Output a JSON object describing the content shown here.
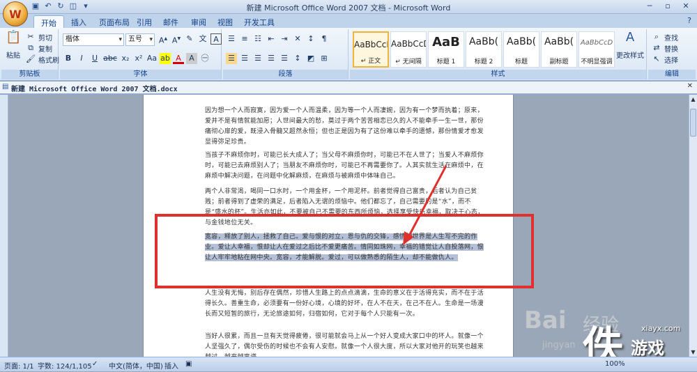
{
  "window": {
    "title": "新建 Microsoft Office Word 2007 文档 - Microsoft Word",
    "office_button_glyph": "W"
  },
  "ribbon_tabs": [
    "开始",
    "插入",
    "页面布局",
    "引用",
    "邮件",
    "审阅",
    "视图",
    "开发工具"
  ],
  "clipboard": {
    "paste": "粘贴",
    "cut": "剪切",
    "copy": "复制",
    "format_painter": "格式刷",
    "group_label": "剪贴板"
  },
  "font": {
    "name": "楷体",
    "size": "五号",
    "group_label": "字体"
  },
  "paragraph": {
    "group_label": "段落"
  },
  "styles": {
    "items": [
      {
        "preview": "AaBbCcD",
        "name": "↵ 正文"
      },
      {
        "preview": "AaBbCcD",
        "name": "↵ 无间隔"
      },
      {
        "preview": "AaB",
        "name": "标题 1"
      },
      {
        "preview": "AaBb(",
        "name": "标题 2"
      },
      {
        "preview": "AaBb(",
        "name": "标题"
      },
      {
        "preview": "AaBb(",
        "name": "副标题"
      },
      {
        "preview": "AaBbCcD",
        "name": "不明显强调"
      }
    ],
    "change_styles": "更改样式",
    "group_label": "样式"
  },
  "editing": {
    "find": "查找",
    "replace": "替换",
    "select": "选择",
    "group_label": "编辑"
  },
  "document_tab": "新建 Microsoft Office Word 2007 文档.docx",
  "document": {
    "p1": "因为想一个人而寂寞，因为爱一个人而温柔，因为等一个人而凄婉，因为有一个梦而执着；原来，爱并不是有情就能加愿；人世间最大的愁，莫过于两个苦苦相恋已久的人不能牵手一生一世，那份痛彻心扉的爱，既浸入骨髓又超然永恒；但也正是因为有了这份难以牵手的遗憾，那份情爱才愈发显得弥足珍贵。",
    "p2": "当孩子不麻烦你时，可能已长大成人了；当父母不麻烦你时，可能已不在人世了；当爱人不麻烦你时，可能已去麻烦别人了；当朋友不麻烦你时，可能已不再需要你了。人其实就生活在麻烦中，在麻烦中解决问题，在问题中化解麻烦，在麻烦与被麻烦中体味自己。",
    "p3": "两个人非常渴，喝同一口水时，一个用金杯，一个用泥杯。前者觉得自己富贵，后者认为自己贫贱；前者得到了虚荣的满足，后者陷入无谓的烦恼中。他们都忘了，自己需要的是“水”，而不是“盛水的杯”。生活亦如此，不要被自己不需要的东西所烦恼，选择享受快乐幸福，取决于心态，与金钱地位无关。",
    "p4": "宽容，释放了别人，拯救了自己。爱与恨的对立，恩与仇的交锋，感情的世界是人生写不完的作业。爱让人幸福，恨却让人在爱过之后比不爱更痛苦。情同如珠网，幸福的错觉让人自投落网，恨让人牢牢地粘在网中央。宽容，才能解脱。爱过，可以做熟悉的陌生人，却不能做仇人。",
    "p5": "人生没有无悔，别后存在偶然，珍惜人生路上的点点滴滴，生命的意义在于活得充实，而不在于活得长久。善重生命，必须要有一份好心境，心境的好坏，在人不在天，在己不在人。生命是一场漫长而又短暂的旅行，无论旅途如何，归宿如何，它对于每个人只能有一次。",
    "p6": "当好人很累，而且一旦有天觉得疲倦，很可能就会马上从一个好人变成大家口中的坏人。就像一个人坚强久了，偶尔受伤的时候也不会有人安慰。就像一个人很大度，所以大家对他开的玩笑也越来越过，越来越离谱。"
  },
  "status_bar": {
    "page": "页面: 1/1",
    "words": "字数: 124/1,105",
    "language": "中文(简体，中国)",
    "insert_mode": "插入",
    "zoom": "100%"
  },
  "watermark": {
    "baidu": "Bai",
    "jingyan": "经验",
    "jingyan_url": "jingyan",
    "site": "xiayx.com",
    "game": "游戏"
  },
  "colors": {
    "annotation_red": "#e0302e",
    "selection": "#b4bfd8"
  }
}
